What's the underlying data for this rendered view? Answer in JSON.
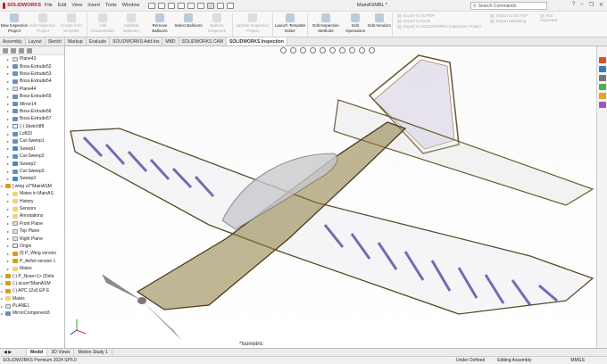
{
  "app": {
    "brand": "SOLIDWORKS",
    "document_title": "MainASMBL *",
    "search_placeholder": "Search Commands"
  },
  "menu": [
    "File",
    "Edit",
    "View",
    "Insert",
    "Tools",
    "Window"
  ],
  "ribbon": {
    "buttons": [
      {
        "label": "New Inspection Project",
        "enabled": true
      },
      {
        "label": "Edit Inspection Project",
        "enabled": false
      },
      {
        "label": "Create from template",
        "enabled": false
      },
      {
        "label": "Add Characteristic",
        "enabled": false
      },
      {
        "label": "Add/Edit Balloons",
        "enabled": false
      },
      {
        "label": "Remove Balloons",
        "enabled": true
      },
      {
        "label": "Select Balloons",
        "enabled": true
      },
      {
        "label": "Balloon Sequence",
        "enabled": false
      },
      {
        "label": "Update Inspection Project",
        "enabled": false
      },
      {
        "label": "Launch Template Editor",
        "enabled": true
      },
      {
        "label": "Edit Inspection Methods",
        "enabled": true
      },
      {
        "label": "Edit Operations",
        "enabled": true
      },
      {
        "label": "Edit Vendors",
        "enabled": true
      }
    ],
    "export_group_1": [
      "Export to 2D PDF",
      "Export to Excel",
      "Export to SOLIDWORKS Inspection Project"
    ],
    "export_group_2": [
      "Export to 3D PDF",
      "Export eDrawing"
    ],
    "not_inspected": "Not inspected"
  },
  "tabs": [
    "Assembly",
    "Layout",
    "Sketch",
    "Markup",
    "Evaluate",
    "SOLIDWORKS Add-Ins",
    "MBD",
    "SOLIDWORKS CAM",
    "SOLIDWORKS Inspection"
  ],
  "active_tab": "SOLIDWORKS Inspection",
  "tree": [
    {
      "label": "Plane43",
      "icon": "plane",
      "indent": 1
    },
    {
      "label": "Boss-Extrude52",
      "icon": "feat",
      "indent": 1
    },
    {
      "label": "Boss-Extrude53",
      "icon": "feat",
      "indent": 1
    },
    {
      "label": "Boss-Extrude54",
      "icon": "feat",
      "indent": 1
    },
    {
      "label": "Plane44",
      "icon": "plane",
      "indent": 1
    },
    {
      "label": "Boss-Extrude55",
      "icon": "feat",
      "indent": 1
    },
    {
      "label": "Mirror14",
      "icon": "feat",
      "indent": 1
    },
    {
      "label": "Boss-Extrude56",
      "icon": "feat",
      "indent": 1
    },
    {
      "label": "Boss-Extrude57",
      "icon": "feat",
      "indent": 1
    },
    {
      "label": "(-) Sketch88",
      "icon": "sketch",
      "indent": 1
    },
    {
      "label": "Loft33",
      "icon": "feat",
      "indent": 1
    },
    {
      "label": "Cut-Sweep1",
      "icon": "feat",
      "indent": 1
    },
    {
      "label": "Sweep1",
      "icon": "sweep",
      "indent": 1
    },
    {
      "label": "Cut-Sweep2",
      "icon": "feat",
      "indent": 1
    },
    {
      "label": "Sweep2",
      "icon": "sweep",
      "indent": 1
    },
    {
      "label": "Cut-Sweep3",
      "icon": "feat",
      "indent": 1
    },
    {
      "label": "Sweep3",
      "icon": "sweep",
      "indent": 1
    },
    {
      "label": "[ wing v2^MainASM",
      "icon": "asm",
      "indent": 0
    },
    {
      "label": "Mates in MainAS",
      "icon": "folder",
      "indent": 1
    },
    {
      "label": "History",
      "icon": "folder",
      "indent": 1
    },
    {
      "label": "Sensors",
      "icon": "folder",
      "indent": 1
    },
    {
      "label": "Annotations",
      "icon": "folder",
      "indent": 1
    },
    {
      "label": "Front Plane",
      "icon": "plane",
      "indent": 1
    },
    {
      "label": "Top Plane",
      "icon": "plane",
      "indent": 1
    },
    {
      "label": "Right Plane",
      "icon": "plane",
      "indent": 1
    },
    {
      "label": "Origin",
      "icon": "sketch",
      "indent": 1
    },
    {
      "label": "(f) P_Wing version",
      "icon": "asm",
      "indent": 1
    },
    {
      "label": "P_Airfoil version 1",
      "icon": "asm",
      "indent": 1
    },
    {
      "label": "Mates",
      "icon": "folder",
      "indent": 1
    },
    {
      "label": "(-) P_Nose<1> (Defa",
      "icon": "asm",
      "indent": 0
    },
    {
      "label": "(-) acum^MainASM",
      "icon": "asm",
      "indent": 0
    },
    {
      "label": "(-) APC 12x6 EP E",
      "icon": "asm",
      "indent": 0
    },
    {
      "label": "Mates",
      "icon": "folder",
      "indent": 0
    },
    {
      "label": "PLANE1",
      "icon": "plane",
      "indent": 0
    },
    {
      "label": "MirrorComponent3",
      "icon": "feat",
      "indent": 0
    }
  ],
  "viewport": {
    "view_name": "*Isometric"
  },
  "bottom_tabs": [
    "Model",
    "3D Views",
    "Motion Study 1"
  ],
  "active_bottom_tab": "Model",
  "status": {
    "left": "SOLIDWORKS Premium 2024 SP5.0",
    "defined": "Under Defined",
    "editing": "Editing Assembly",
    "units": "MMGS"
  }
}
